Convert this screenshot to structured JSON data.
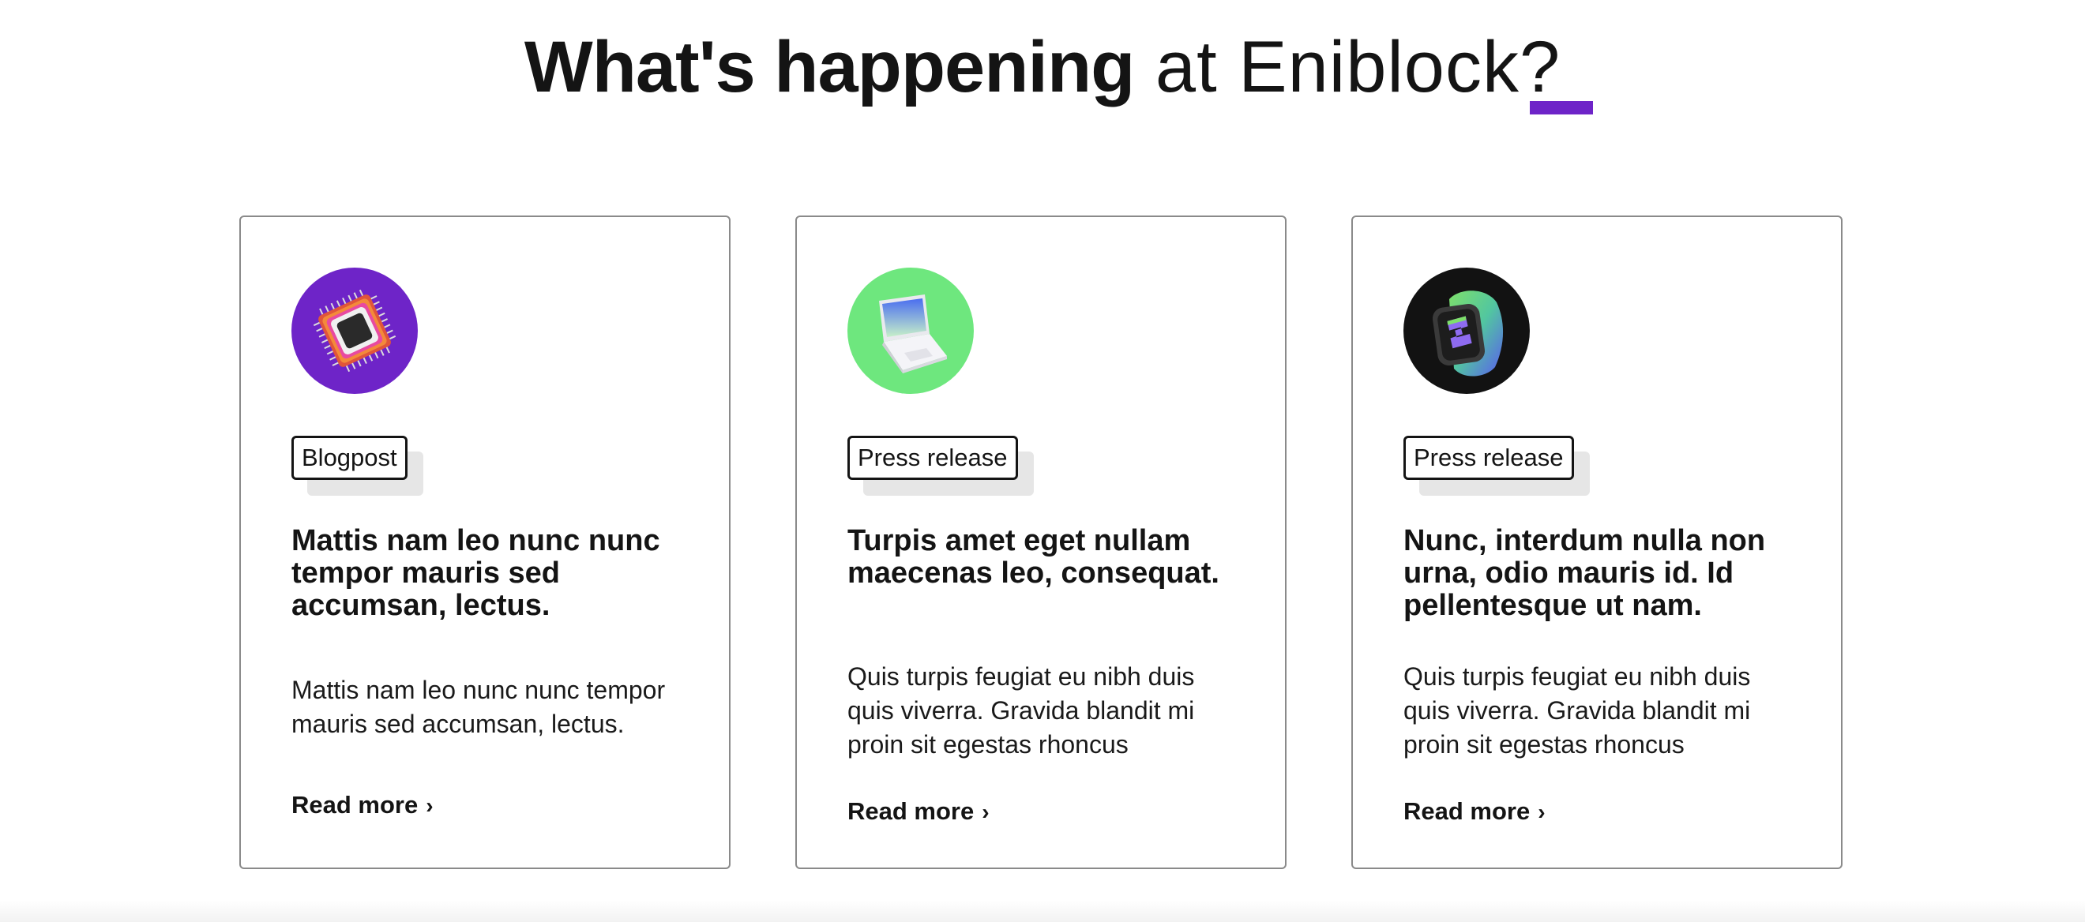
{
  "heading": {
    "bold": "What's happening",
    "light": " at Eniblock?",
    "accent_color": "#6e24c8"
  },
  "cards": [
    {
      "icon": "microchip-icon",
      "icon_bg": "#6e24c8",
      "tag": "Blogpost",
      "title": "Mattis nam leo nunc nunc tempor mauris sed accumsan, lectus.",
      "body": "Mattis nam leo nunc nunc tempor mauris sed accumsan, lectus.",
      "link": "Read more"
    },
    {
      "icon": "laptop-icon",
      "icon_bg": "#6ee77e",
      "tag": "Press release",
      "title": "Turpis amet eget nullam maecenas leo, consequat.",
      "body": "Quis turpis feugiat eu nibh duis quis viverra. Gravida blandit mi proin sit egestas rhoncus",
      "link": "Read more"
    },
    {
      "icon": "smartwatch-icon",
      "icon_bg": "#121212",
      "tag": "Press release",
      "title": "Nunc, interdum nulla non urna, odio mauris id. Id pellentesque ut nam.",
      "body": "Quis turpis feugiat eu nibh duis quis viverra. Gravida blandit mi proin sit egestas rhoncus",
      "link": "Read more"
    }
  ]
}
